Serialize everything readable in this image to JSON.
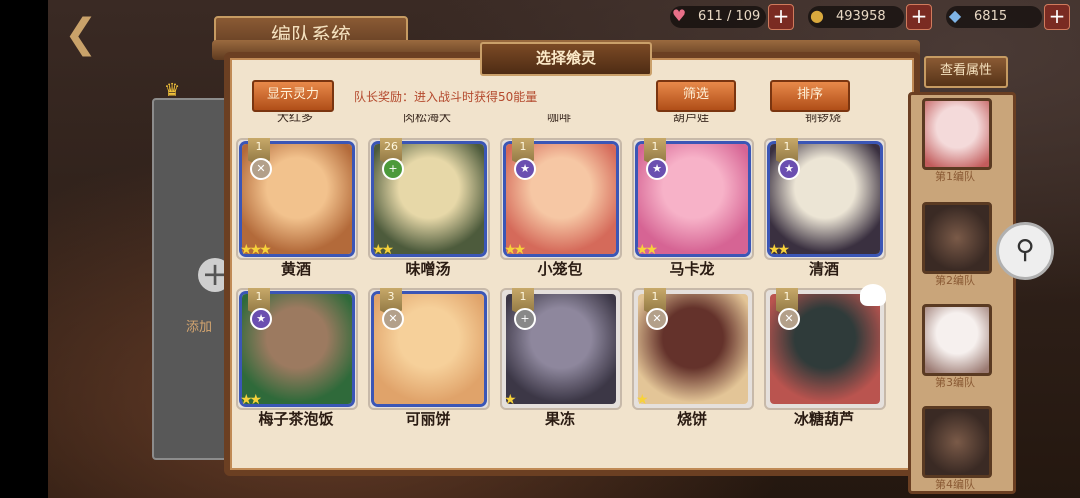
{
  "header": {
    "back_icon": "back-arrow-icon",
    "title": "编队系统"
  },
  "resources": [
    {
      "icon": "heart-icon",
      "value": "611 / 109",
      "color": "#e86f88"
    },
    {
      "icon": "coin-icon",
      "value": "493958",
      "color": "#d9a93d"
    },
    {
      "icon": "crystal-icon",
      "value": "6815",
      "color": "#7fb4e6"
    }
  ],
  "left_slot": {
    "add_text": "添加"
  },
  "panel": {
    "title": "选择飨灵",
    "show_power_label": "显示灵力",
    "bonus_text": "队长奖励：进入战斗时获得50能量",
    "filter_label": "筛选",
    "sort_label": "排序"
  },
  "partial_row": [
    "大红多",
    "肉松海大",
    "咖啡",
    "葫芦娃",
    "铜锣烧"
  ],
  "cards": [
    {
      "name": "黄酒",
      "level": "1",
      "elem": "sword",
      "stars": 3,
      "border": "blue",
      "c1": "#f2c28d",
      "c2": "#b36a3a"
    },
    {
      "name": "味噌汤",
      "level": "26",
      "elem": "leaf",
      "stars": 2,
      "border": "blue",
      "c1": "#e7d8a8",
      "c2": "#4d5b3c"
    },
    {
      "name": "小笼包",
      "level": "1",
      "elem": "star",
      "stars": 2,
      "border": "blue",
      "c1": "#f6c7a4",
      "c2": "#d56a5a"
    },
    {
      "name": "马卡龙",
      "level": "1",
      "elem": "star",
      "stars": 2,
      "border": "blue",
      "c1": "#f7b2c8",
      "c2": "#d66494"
    },
    {
      "name": "清酒",
      "level": "1",
      "elem": "star",
      "stars": 2,
      "border": "blue",
      "c1": "#ece5d5",
      "c2": "#3a3040"
    },
    {
      "name": "梅子茶泡饭",
      "level": "1",
      "elem": "star",
      "stars": 2,
      "border": "blue",
      "c1": "#9c7a60",
      "c2": "#2f6a3a"
    },
    {
      "name": "可丽饼",
      "level": "3",
      "elem": "sword",
      "stars": 0,
      "border": "blue",
      "c1": "#f6d09a",
      "c2": "#e0a36a"
    },
    {
      "name": "果冻",
      "level": "1",
      "elem": "plus",
      "stars": 1,
      "border": "gray",
      "c1": "#8f86a0",
      "c2": "#3c3748"
    },
    {
      "name": "烧饼",
      "level": "1",
      "elem": "sword",
      "stars": 1,
      "border": "gray",
      "c1": "#6b3028",
      "c2": "#e8c48e"
    },
    {
      "name": "冰糖葫芦",
      "level": "1",
      "elem": "sword",
      "stars": 0,
      "border": "gray",
      "c1": "#2d3b3a",
      "c2": "#c8504a"
    }
  ],
  "sidebar": {
    "view_attr_label": "查看属性",
    "zoom_icon": "magnifier-icon",
    "slots": [
      {
        "label": "第1编队",
        "filled": true,
        "c1": "#f4dada",
        "c2": "#c25c5c"
      },
      {
        "label": "第2编队",
        "filled": false
      },
      {
        "label": "第3编队",
        "filled": true,
        "c1": "#f6f0ee",
        "c2": "#9b7a72"
      },
      {
        "label": "第4编队",
        "filled": false
      }
    ]
  }
}
